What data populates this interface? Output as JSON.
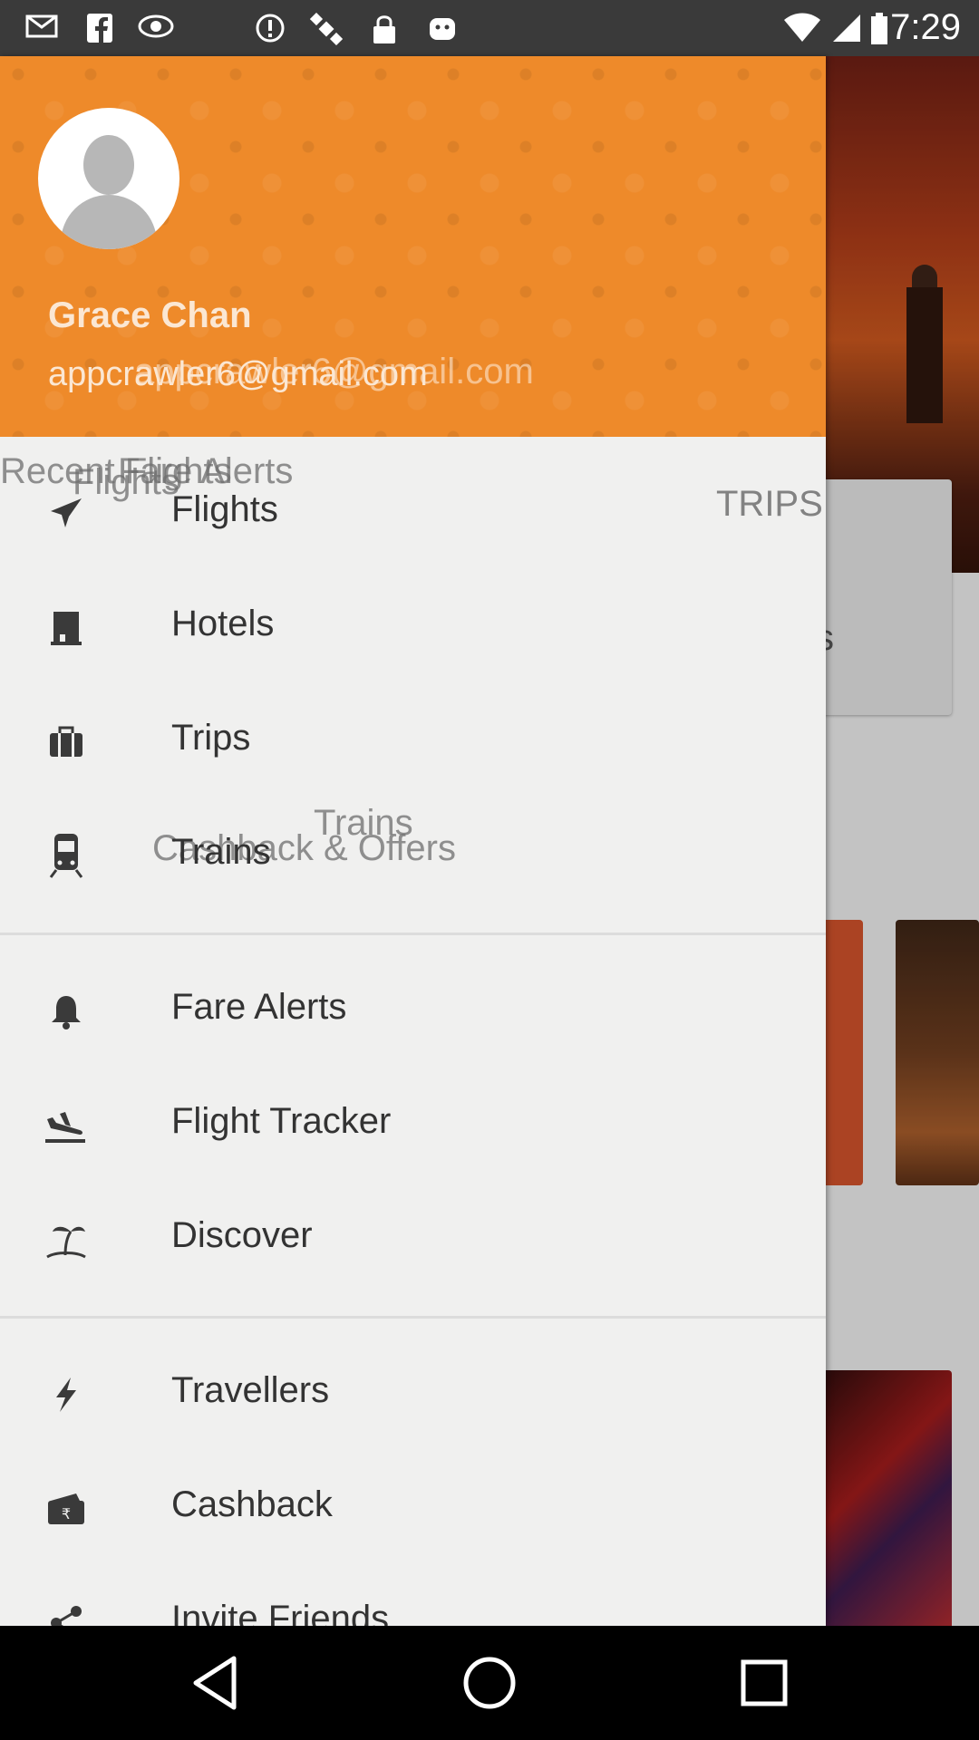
{
  "status_bar": {
    "time": "7:29",
    "icons": [
      "mail-icon",
      "facebook-icon",
      "eye-icon",
      "alert-icon",
      "satellite-icon",
      "lock-icon",
      "android-icon",
      "wifi-icon",
      "signal-icon",
      "battery-icon"
    ]
  },
  "background_app": {
    "tab_fragment": "s"
  },
  "drawer": {
    "user": {
      "name": "Grace Chan",
      "email": "appcrawler6@gmail.com",
      "email_ghost": "appcrawler6@gmail.com"
    },
    "ghost_texts": {
      "recent_flights": "Recent Flights",
      "fare_alerts": "Fare Alerts",
      "flights": "Flights",
      "trips_tab": "TRIPS",
      "trains": "Trains",
      "cashback_offers": "Cashback & Offers"
    },
    "menu": [
      {
        "label": "Flights",
        "icon": "airplane-icon"
      },
      {
        "label": "Hotels",
        "icon": "hotel-icon"
      },
      {
        "label": "Trips",
        "icon": "briefcase-icon"
      },
      {
        "label": "Trains",
        "icon": "train-icon"
      },
      {
        "label": "Fare Alerts",
        "icon": "bell-icon"
      },
      {
        "label": "Flight Tracker",
        "icon": "flight-landing-icon"
      },
      {
        "label": "Discover",
        "icon": "island-icon"
      },
      {
        "label": "Travellers",
        "icon": "lightning-icon"
      },
      {
        "label": "Cashback",
        "icon": "cash-icon"
      },
      {
        "label": "Invite Friends",
        "icon": "share-icon"
      }
    ]
  },
  "nav_bar": {
    "buttons": [
      "back-button",
      "home-button",
      "recents-button"
    ]
  },
  "colors": {
    "header_orange": "#ee8a2a",
    "drawer_bg": "#f0f0ef",
    "text_dark": "#333333"
  }
}
